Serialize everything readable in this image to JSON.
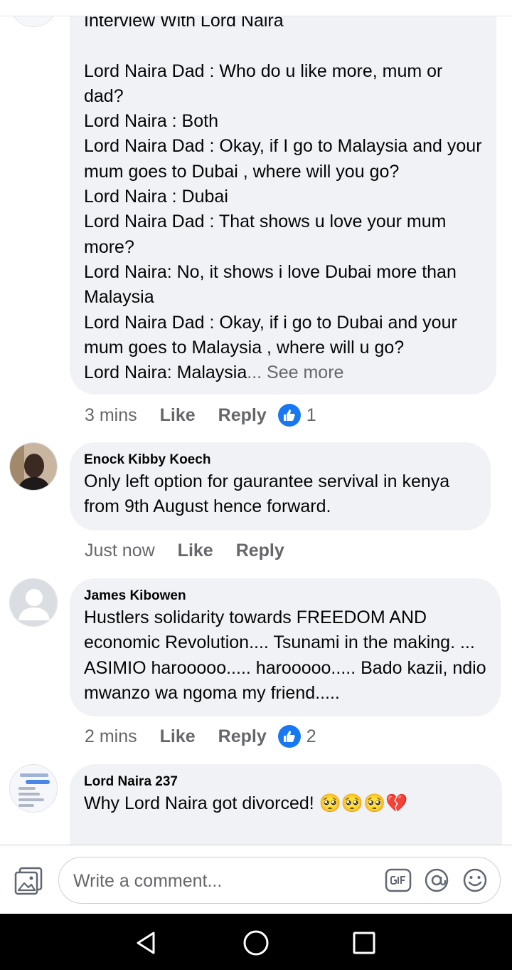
{
  "comments": [
    {
      "author": "",
      "body": "Interview With Lord Naira\n\nLord Naira Dad : Who do u like more, mum or dad?\nLord Naira : Both\nLord Naira Dad : Okay, if I go to Malaysia and your mum goes to Dubai , where will you go?\nLord Naira : Dubai\nLord Naira Dad : That shows u love your mum more?\nLord Naira: No, it shows i love Dubai more than Malaysia\nLord Naira Dad : Okay, if i go to Dubai and your mum goes to Malaysia , where will u go?\nLord Naira: Malaysia",
      "see_more": "... See more",
      "time": "3 mins",
      "like_label": "Like",
      "reply_label": "Reply",
      "reaction_count": "1"
    },
    {
      "author": "Enock Kibby Koech",
      "body": "Only left option for gaurantee servival in kenya from 9th August hence forward.",
      "time": "Just now",
      "like_label": "Like",
      "reply_label": "Reply"
    },
    {
      "author": "James Kibowen",
      "body": "Hustlers solidarity towards FREEDOM AND economic Revolution.... Tsunami in the making. ... ASIMIO harooooo..... harooooo..... Bado kazii, ndio mwanzo wa ngoma my friend.....",
      "time": "2 mins",
      "like_label": "Like",
      "reply_label": "Reply",
      "reaction_count": "2"
    },
    {
      "author": "Lord Naira 237",
      "body": "Why Lord Naira got divorced! 🥺🥺🥺💔"
    }
  ],
  "composer": {
    "placeholder": "Write a comment...",
    "icons": [
      "photo-icon",
      "gif-icon",
      "mention-icon",
      "emoji-icon"
    ]
  },
  "navbar": {
    "icons": [
      "back-icon",
      "home-icon",
      "recents-icon"
    ]
  },
  "colors": {
    "bubble": "#f0f2f5",
    "meta_text": "#65676b",
    "like_blue": "#1877f2",
    "nav_bg": "#000000"
  }
}
